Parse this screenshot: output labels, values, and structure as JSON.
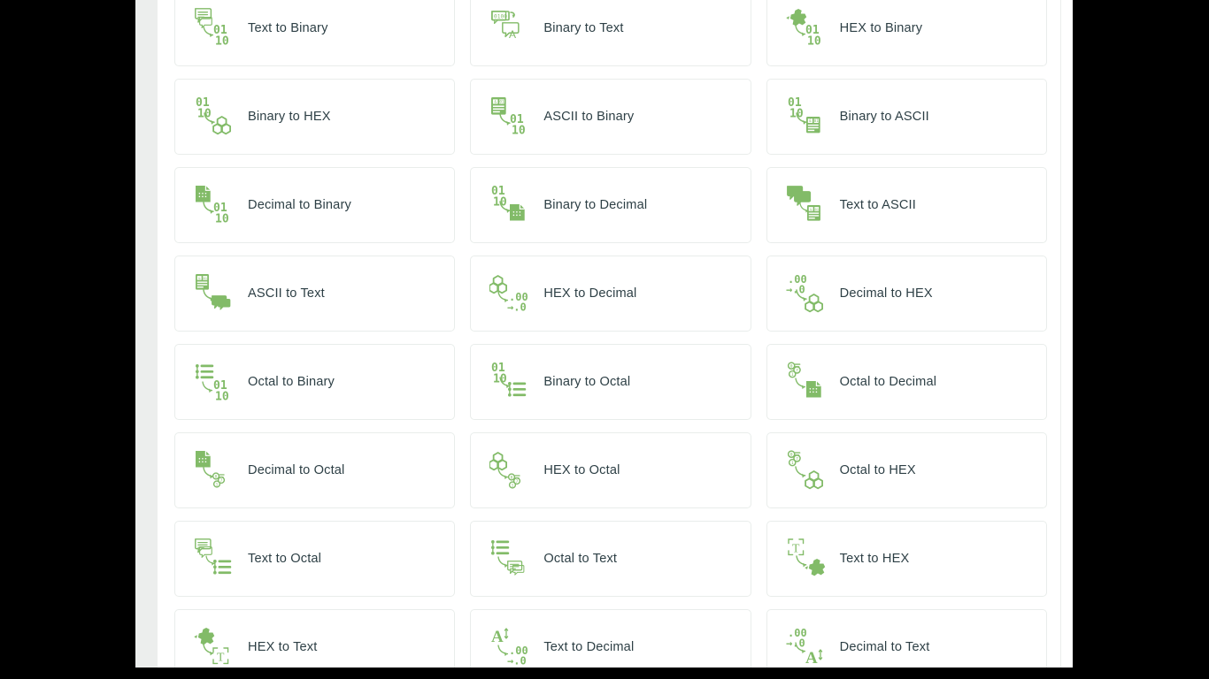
{
  "theme": {
    "icon_green": "#82bb68",
    "label_color": "#2d3f45",
    "card_bg": "#ffffff",
    "card_border": "#e9edeb",
    "page_bg": "#ffffff",
    "gutter_bg": "#eceeed",
    "letterbox": "#000000"
  },
  "converters": [
    {
      "label": "Text to Binary",
      "icon": "text-to-binary-icon"
    },
    {
      "label": "Binary to Text",
      "icon": "binary-to-text-icon"
    },
    {
      "label": "HEX to Binary",
      "icon": "hex-to-binary-icon"
    },
    {
      "label": "Binary to HEX",
      "icon": "binary-to-hex-icon"
    },
    {
      "label": "ASCII to Binary",
      "icon": "ascii-to-binary-icon"
    },
    {
      "label": "Binary to ASCII",
      "icon": "binary-to-ascii-icon"
    },
    {
      "label": "Decimal to Binary",
      "icon": "decimal-to-binary-icon"
    },
    {
      "label": "Binary to Decimal",
      "icon": "binary-to-decimal-icon"
    },
    {
      "label": "Text to ASCII",
      "icon": "text-to-ascii-icon"
    },
    {
      "label": "ASCII to Text",
      "icon": "ascii-to-text-icon"
    },
    {
      "label": "HEX to Decimal",
      "icon": "hex-to-decimal-icon"
    },
    {
      "label": "Decimal to HEX",
      "icon": "decimal-to-hex-icon"
    },
    {
      "label": "Octal to Binary",
      "icon": "octal-to-binary-icon"
    },
    {
      "label": "Binary to Octal",
      "icon": "binary-to-octal-icon"
    },
    {
      "label": "Octal to Decimal",
      "icon": "octal-to-decimal-icon"
    },
    {
      "label": "Decimal to Octal",
      "icon": "decimal-to-octal-icon"
    },
    {
      "label": "HEX to Octal",
      "icon": "hex-to-octal-icon"
    },
    {
      "label": "Octal to HEX",
      "icon": "octal-to-hex-icon"
    },
    {
      "label": "Text to Octal",
      "icon": "text-to-octal-icon"
    },
    {
      "label": "Octal to Text",
      "icon": "octal-to-text-icon"
    },
    {
      "label": "Text to HEX",
      "icon": "text-to-hex-icon"
    },
    {
      "label": "HEX to Text",
      "icon": "hex-to-text-icon"
    },
    {
      "label": "Text to Decimal",
      "icon": "text-to-decimal-icon"
    },
    {
      "label": "Decimal to Text",
      "icon": "decimal-to-text-icon"
    }
  ]
}
